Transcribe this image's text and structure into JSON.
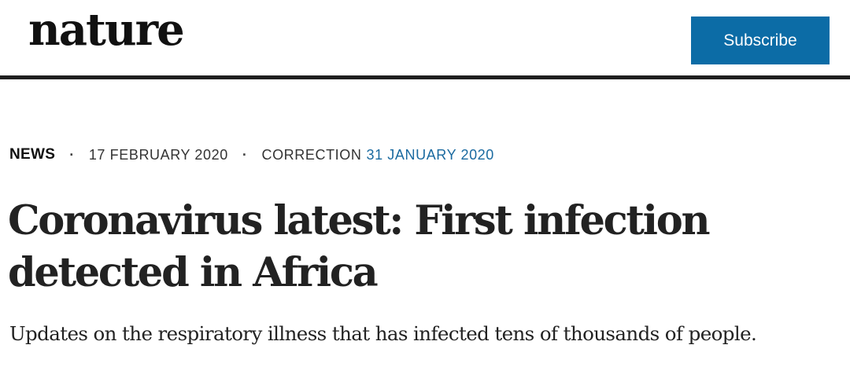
{
  "header": {
    "logo_text": "nature",
    "subscribe_label": "Subscribe"
  },
  "article": {
    "type": "NEWS",
    "separator": "·",
    "published_date": "17 FEBRUARY 2020",
    "correction_label": "CORRECTION",
    "correction_date": "31 JANUARY 2020",
    "title_line1": "Coronavirus latest: First infection",
    "title_line2": "detected in Africa",
    "standfirst": "Updates on the respiratory illness that has infected tens of thousands of people."
  },
  "colors": {
    "accent": "#0c6ca6",
    "link": "#1a6aa0",
    "rule": "#1f1f1f",
    "text": "#222222"
  }
}
